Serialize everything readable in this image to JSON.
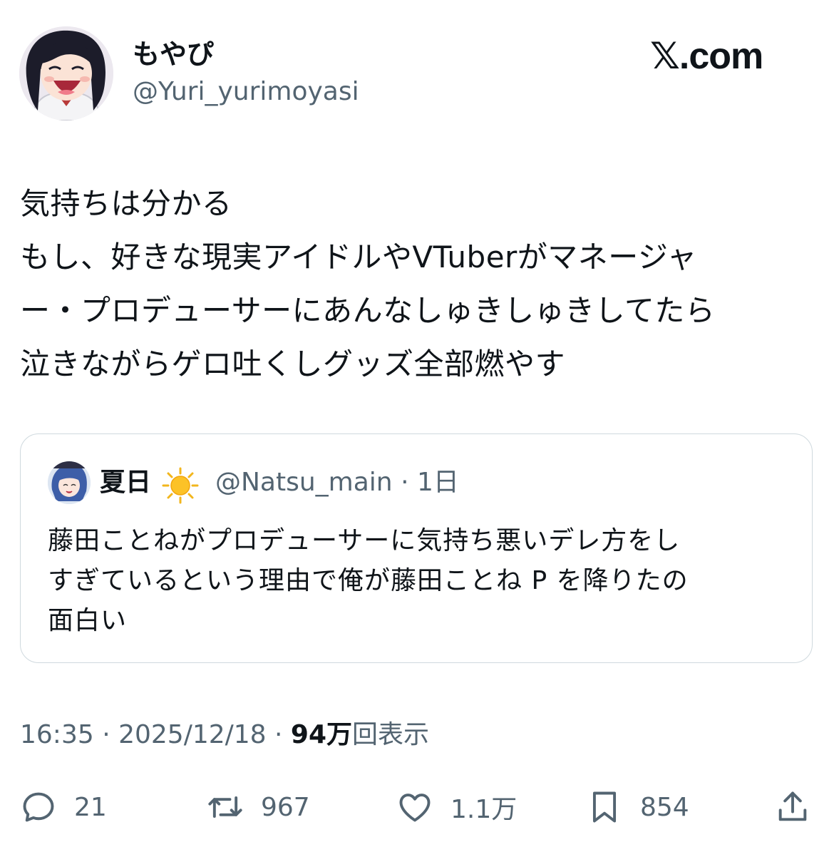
{
  "author": {
    "name": "もやぴ",
    "handle": "@Yuri_yurimoyasi",
    "avatar_icon": "anime-girl-laughing-avatar"
  },
  "site_logo": "𝕏.com",
  "tweet": {
    "text": "気持ちは分かる\nもし、好きな現実アイドルやVTuberがマネージャ\nー・プロデューサーにあんなしゅきしゅきしてたら\n泣きながらゲロ吐くしグッズ全部燃やす"
  },
  "quoted": {
    "name": "夏日",
    "emoji_icon": "sun-icon",
    "meta": "@Natsu_main · 1日",
    "text": "藤田ことねがプロデューサーに気持ち悪いデレ方をし\nすぎているという理由で俺が藤田ことね P を降りたの\n面白い"
  },
  "meta": {
    "time_date": "16:35 · 2025/12/18 · ",
    "views_count": "94万",
    "views_label": "回表示"
  },
  "actions": {
    "replies": "21",
    "retweets": "967",
    "likes": "1.1万",
    "bookmarks": "854"
  },
  "colors": {
    "text": "#0f1419",
    "secondary": "#536471",
    "border": "#cfd9de"
  }
}
